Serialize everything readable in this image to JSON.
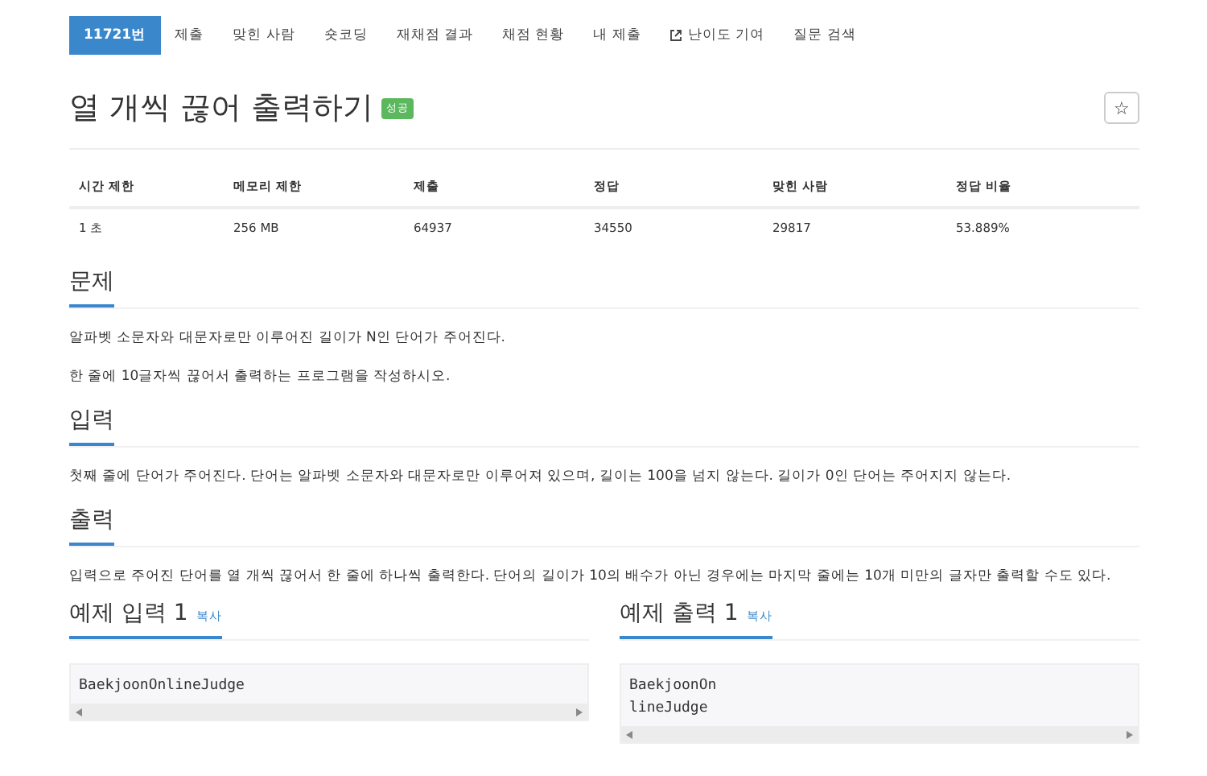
{
  "nav": [
    {
      "label": "11721번",
      "selected": true,
      "kind": "tab"
    },
    {
      "label": "제출",
      "selected": false,
      "kind": "tab"
    },
    {
      "label": "맞힌 사람",
      "selected": false,
      "kind": "tab"
    },
    {
      "label": "숏코딩",
      "selected": false,
      "kind": "tab"
    },
    {
      "label": "재채점 결과",
      "selected": false,
      "kind": "tab"
    },
    {
      "label": "채점 현황",
      "selected": false,
      "kind": "tab"
    },
    {
      "label": "내 제출",
      "selected": false,
      "kind": "tab"
    },
    {
      "label": "난이도 기여",
      "selected": false,
      "kind": "external"
    },
    {
      "label": "질문 검색",
      "selected": false,
      "kind": "tab"
    }
  ],
  "title": "열 개씩 끊어 출력하기",
  "badge": "성공",
  "star": "☆",
  "stats": {
    "columns": [
      "시간 제한",
      "메모리 제한",
      "제출",
      "정답",
      "맞힌 사람",
      "정답 비율"
    ],
    "row": [
      "1 초",
      "256 MB",
      "64937",
      "34550",
      "29817",
      "53.889%"
    ]
  },
  "sections": [
    {
      "heading": "문제",
      "paragraphs": [
        "알파벳 소문자와 대문자로만 이루어진 길이가 N인 단어가 주어진다.",
        "한 줄에 10글자씩 끊어서 출력하는 프로그램을 작성하시오."
      ]
    },
    {
      "heading": "입력",
      "paragraphs": [
        "첫째 줄에 단어가 주어진다. 단어는 알파벳 소문자와 대문자로만 이루어져 있으며, 길이는 100을 넘지 않는다. 길이가 0인 단어는 주어지지 않는다."
      ]
    },
    {
      "heading": "출력",
      "paragraphs": [
        "입력으로 주어진 단어를 열 개씩 끊어서 한 줄에 하나씩 출력한다. 단어의 길이가 10의 배수가 아닌 경우에는 마지막 줄에는 10개 미만의 글자만 출력할 수도 있다."
      ]
    }
  ],
  "samples": [
    {
      "heading": "예제 입력 1",
      "copy": "복사",
      "lines": [
        "BaekjoonOnlineJudge"
      ]
    },
    {
      "heading": "예제 출력 1",
      "copy": "복사",
      "lines": [
        "BaekjoonOn",
        "lineJudge"
      ]
    }
  ]
}
